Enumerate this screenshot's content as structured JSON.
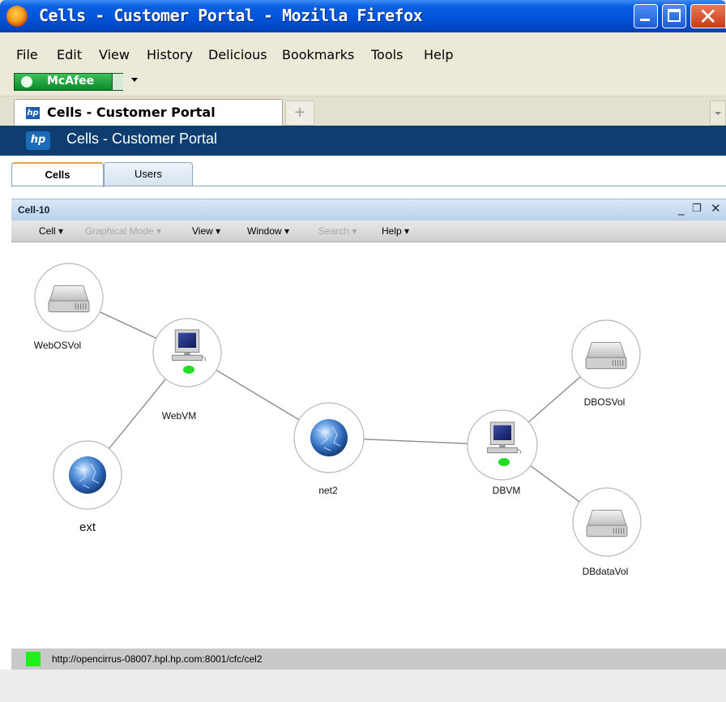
{
  "window": {
    "title": "Cells - Customer Portal - Mozilla Firefox"
  },
  "menu": [
    "File",
    "Edit",
    "View",
    "History",
    "Delicious",
    "Bookmarks",
    "Tools",
    "Help"
  ],
  "toolbar": {
    "mcafee_label": "McAfee"
  },
  "browser_tab": {
    "label": "Cells - Customer Portal"
  },
  "portal": {
    "title": "Cells - Customer Portal",
    "logo_text": "hp",
    "tabs": [
      "Cells",
      "Users"
    ]
  },
  "cell_window": {
    "title": "Cell-10",
    "menu": [
      {
        "label": "Cell ▾",
        "enabled": true
      },
      {
        "label": "Graphical Mode ▾",
        "enabled": false
      },
      {
        "label": "View ▾",
        "enabled": true
      },
      {
        "label": "Window ▾",
        "enabled": true
      },
      {
        "label": "Search ▾",
        "enabled": false
      },
      {
        "label": "Help ▾",
        "enabled": true
      }
    ]
  },
  "topology": {
    "nodes": [
      {
        "id": "WebOSVol",
        "label": "WebOSVol",
        "type": "disk-icon"
      },
      {
        "id": "WebVM",
        "label": "WebVM",
        "type": "computer-icon",
        "status": "#22dd22"
      },
      {
        "id": "ext",
        "label": "ext",
        "type": "globe-icon"
      },
      {
        "id": "net2",
        "label": "net2",
        "type": "globe-icon"
      },
      {
        "id": "DBVM",
        "label": "DBVM",
        "type": "computer-icon",
        "status": "#22dd22"
      },
      {
        "id": "DBOSVol",
        "label": "DBOSVol",
        "type": "disk-icon"
      },
      {
        "id": "DBdataVol",
        "label": "DBdataVol",
        "type": "disk-icon"
      }
    ],
    "edges": [
      [
        "WebOSVol",
        "WebVM"
      ],
      [
        "WebVM",
        "ext"
      ],
      [
        "WebVM",
        "net2"
      ],
      [
        "net2",
        "DBVM"
      ],
      [
        "DBVM",
        "DBOSVol"
      ],
      [
        "DBVM",
        "DBdataVol"
      ]
    ]
  },
  "status": {
    "url": "http://opencirrus-08007.hpl.hp.com:8001/cfc/cel2",
    "led_color": "#1ef01e"
  }
}
